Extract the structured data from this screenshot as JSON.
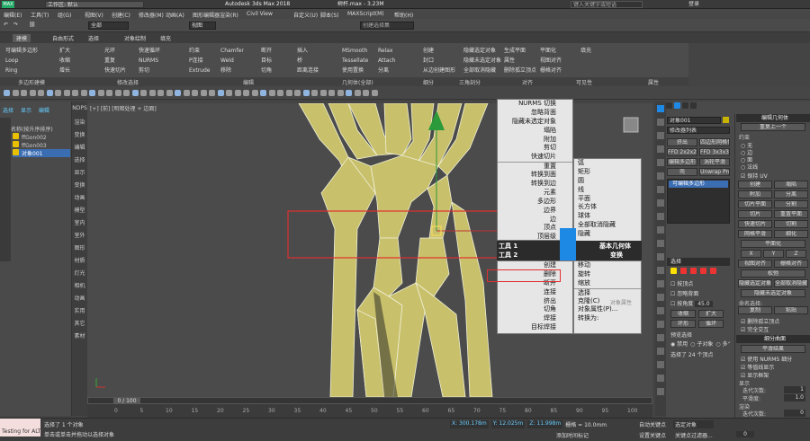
{
  "title": {
    "app": "Autodesk 3ds Max 2018",
    "file": "树杆.max - 3.23M",
    "workspace": "工作区: 默认",
    "search_placeholder": "键入关键字或短语",
    "user": "登录"
  },
  "menubar": [
    "编辑(E)",
    "工具(T)",
    "组(G)",
    "视图(V)",
    "创建(C)",
    "修改器(M)",
    "动画(A)",
    "图形编辑器",
    "渲染(R)",
    "Civil View",
    "自定义(U)",
    "脚本(S)",
    "MAXScript(M)",
    "帮助(H)"
  ],
  "toolbar": {
    "selection_filter": "全部",
    "view": "视图",
    "selection_set": "创建选择集"
  },
  "ribbon": {
    "tabs": [
      "建模",
      "自由形式",
      "选择",
      "对象绘制",
      "填充"
    ],
    "groups": [
      "多边形建模",
      "修改选择",
      "编辑",
      "几何体(全部)",
      "细分",
      "三角剖分",
      "对齐",
      "可见性",
      "属性"
    ],
    "items": [
      {
        "label": "可编辑多边形"
      },
      {
        "label": "Loop"
      },
      {
        "label": "Ring"
      },
      {
        "label": "扩大"
      },
      {
        "label": "收缩"
      },
      {
        "label": "增长"
      },
      {
        "label": "光环"
      },
      {
        "label": "重复"
      },
      {
        "label": "快速切片"
      },
      {
        "label": "快速循环"
      },
      {
        "label": "NURMS"
      },
      {
        "label": "剪切"
      },
      {
        "label": "约束"
      },
      {
        "label": "P连接"
      },
      {
        "label": "Extrude"
      },
      {
        "label": "Chamfer"
      },
      {
        "label": "Weld"
      },
      {
        "label": "移除"
      },
      {
        "label": "断开"
      },
      {
        "label": "目标"
      },
      {
        "label": "切角"
      },
      {
        "label": "插入"
      },
      {
        "label": "桥"
      },
      {
        "label": "距离连接"
      },
      {
        "label": "MSmooth"
      },
      {
        "label": "Tessellate"
      },
      {
        "label": "使用置换"
      },
      {
        "label": "Relax"
      },
      {
        "label": "Attach"
      },
      {
        "label": "分离"
      },
      {
        "label": "创建"
      },
      {
        "label": "封口"
      },
      {
        "label": "从边创建图形"
      },
      {
        "label": "隐藏选定对象"
      },
      {
        "label": "隐藏未选定对象"
      },
      {
        "label": "全部取消隐藏"
      },
      {
        "label": "生成平面"
      },
      {
        "label": "属性"
      },
      {
        "label": "删除孤立顶点"
      },
      {
        "label": "平面化"
      },
      {
        "label": "视图对齐"
      },
      {
        "label": "栅格对齐"
      },
      {
        "label": "填充"
      }
    ]
  },
  "scene_explorer": {
    "tabs": [
      "选择",
      "显示",
      "编辑"
    ],
    "header": "名称(按升序排序)",
    "items": [
      "ffGon002",
      "ffGon003",
      "对象001"
    ]
  },
  "left_commands": [
    "NDPS",
    "渲染",
    "变换",
    "编辑",
    "选择",
    "显示",
    "变换",
    "动画",
    "模型",
    "室内",
    "室外",
    "图形",
    "材质",
    "灯光",
    "相机",
    "动画",
    "实用",
    "其它",
    "素材"
  ],
  "viewport": {
    "label": "[+] [前] [明暗处理 + 边面]"
  },
  "quad_menu": {
    "top_left": [
      {
        "label": "NURMS 切换"
      },
      {
        "label": "忽略背面"
      },
      {
        "label": "隐藏未选定对象"
      },
      {
        "label": "塌陷"
      },
      {
        "label": "附加"
      },
      {
        "label": "剪切"
      },
      {
        "label": "快速切片"
      },
      {
        "label": "重置"
      },
      {
        "label": "转换到面"
      },
      {
        "label": "转换到边"
      },
      {
        "label": "元素"
      },
      {
        "label": "多边形"
      },
      {
        "label": "边界"
      },
      {
        "label": "边"
      },
      {
        "label": "顶点"
      },
      {
        "label": "顶层级"
      }
    ],
    "top_right": [
      {
        "label": "弧"
      },
      {
        "label": "矩形"
      },
      {
        "label": "圆"
      },
      {
        "label": "线"
      },
      {
        "label": "平面"
      },
      {
        "label": "长方体"
      },
      {
        "label": "球体"
      },
      {
        "label": "全部取消隐藏"
      },
      {
        "label": "隐藏"
      }
    ],
    "tools1": "工具 1",
    "tools2": "工具 2",
    "basic_geometry": "基本几何体",
    "transform": "变换",
    "bottom_left": [
      {
        "label": "创建"
      },
      {
        "label": "删除"
      },
      {
        "label": "断开"
      },
      {
        "label": "连接"
      },
      {
        "label": "挤出"
      },
      {
        "label": "切角"
      },
      {
        "label": "焊接"
      },
      {
        "label": "目标焊接"
      }
    ],
    "bottom_right": [
      {
        "label": "移动"
      },
      {
        "label": "旋转"
      },
      {
        "label": "缩放"
      },
      {
        "label": "选择"
      },
      {
        "label": "克隆(C)"
      },
      {
        "label": "对象属性(P)..."
      },
      {
        "label": "转换为:"
      }
    ],
    "ghost": "对象属性"
  },
  "command_panel": {
    "object_name": "对象001",
    "modifier_list": "修改器列表",
    "buttons": [
      "挤出",
      "四边形网格化",
      "FFD 2x2x2",
      "FFD 3x3x3",
      "编辑多边形",
      "涡轮平滑",
      "壳",
      "Unwrap Pro"
    ],
    "stack_item": "可编辑多边形",
    "selection_title": "选择",
    "by_vertex": "按顶点",
    "ignore_backfacing": "忽略背面",
    "by_angle": "按角度",
    "angle_value": "45.0",
    "shrink": "收缩",
    "grow": "扩大",
    "ring": "环形",
    "loop": "循环",
    "preview_title": "预览选择",
    "preview_options": [
      "禁用",
      "子对象",
      "多个"
    ],
    "status": "选择了 24 个顶点"
  },
  "edit_geometry": {
    "title": "编辑几何体",
    "repeat": "重复上一个",
    "constraints": "约束",
    "none": "无",
    "edge": "边",
    "face": "面",
    "normal": "法线",
    "preserve_uv": "保持 UV",
    "create": "创建",
    "collapse": "塌陷",
    "attach": "附加",
    "detach": "分离",
    "slice_plane": "切片平面",
    "split": "分割",
    "slice": "切片",
    "reset_plane": "重置平面",
    "quickslice": "快速切片",
    "cut": "切割",
    "meshsmooth": "网格平滑",
    "tessellate": "细化",
    "make_planar": "平面化",
    "x": "X",
    "y": "Y",
    "z": "Z",
    "view_align": "视图对齐",
    "grid_align": "栅格对齐",
    "relax": "松弛",
    "hide_selected": "隐藏选定对象",
    "unhide_all": "全部取消隐藏",
    "hide_unselected": "隐藏未选定对象",
    "named_sel": "命名选择:",
    "copy": "复制",
    "paste": "粘贴",
    "delete_iso": "删除孤立顶点",
    "full_interact": "完全交互",
    "subdiv_title": "细分曲面",
    "smooth_result": "平滑结果",
    "use_nurms": "使用 NURMS 细分",
    "isoline": "等值线显示",
    "show_cage": "显示框架",
    "display": "显示",
    "iterations": "迭代次数:",
    "iter_val": "1",
    "smoothness": "平滑度:",
    "smooth_val": "1.0",
    "render": "渲染",
    "r_iter": "迭代次数:",
    "r_iter_val": "0",
    "r_smooth": "平滑度:",
    "r_smooth_val": "1.0",
    "separate": "分隔方式"
  },
  "timeline": {
    "frame": "0 / 100",
    "ticks": [
      "0",
      "5",
      "10",
      "15",
      "20",
      "25",
      "30",
      "35",
      "40",
      "45",
      "50",
      "55",
      "60",
      "65",
      "70",
      "75",
      "80",
      "85",
      "90",
      "95",
      "100"
    ]
  },
  "statusbar": {
    "script": "Testing for ALT",
    "message": "选择了 1 个对象",
    "hint": "单击或单击并拖动以选择对象",
    "x": "X: 300.178m",
    "y": "Y: 12.025m",
    "z": "Z: 11.998m",
    "grid": "栅格 = 10.0mm",
    "add_tag": "添加时间标记",
    "auto_key": "自动关键点",
    "set_key": "设置关键点",
    "selected": "选定对象",
    "key_filter": "关键点过滤器...",
    "frame": "0"
  },
  "colors": {
    "accent": "#1e88e5",
    "mesh": "#c8c06a",
    "selection": "#e03030",
    "highlight": "#4a90d9"
  }
}
